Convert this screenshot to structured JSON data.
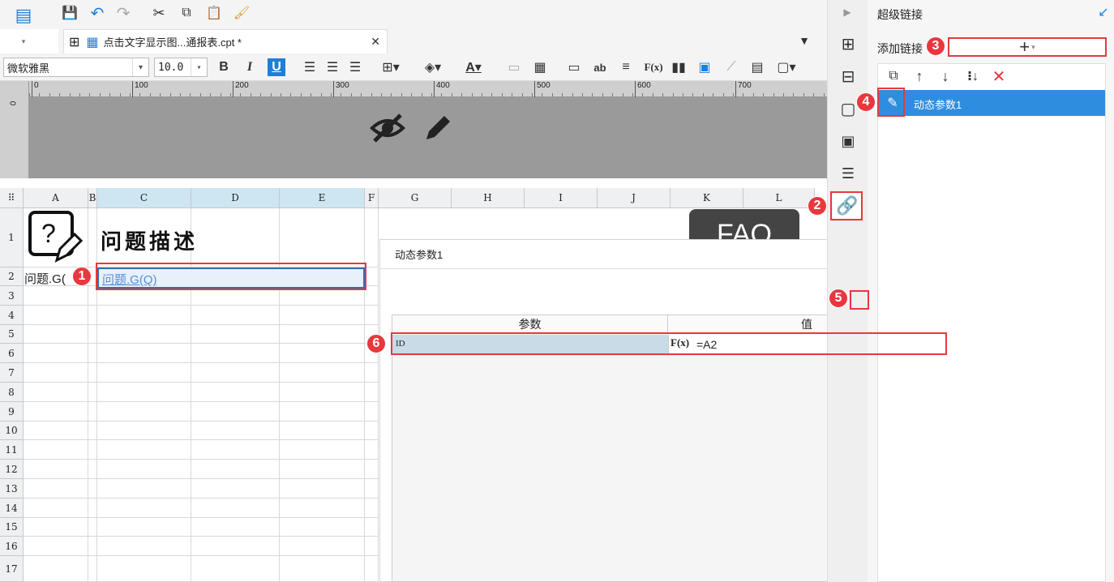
{
  "toolbar": {
    "icons": [
      "report-icon",
      "save-icon",
      "undo-icon",
      "redo-icon",
      "cut-icon",
      "copy-icon",
      "paste-icon",
      "format-painter-icon"
    ]
  },
  "tab": {
    "title": "点击文字显示图...通报表.cpt *",
    "close": "✕"
  },
  "format": {
    "font_name": "微软雅黑",
    "font_size": "10.0",
    "bold": "B",
    "italic": "I",
    "underline": "U",
    "ab": "ab",
    "fx": "F(x)"
  },
  "ruler": {
    "ticks": [
      "0",
      "100",
      "200",
      "300",
      "400",
      "500",
      "600",
      "700"
    ],
    "left": "0"
  },
  "sheet": {
    "corner": "⠿",
    "columns": [
      "A",
      "B",
      "C",
      "D",
      "E",
      "F",
      "G",
      "H",
      "I",
      "J",
      "K",
      "L"
    ],
    "rows": [
      "1",
      "2",
      "3",
      "4",
      "5",
      "6",
      "7",
      "8",
      "9",
      "10",
      "11",
      "12",
      "13",
      "14",
      "15",
      "16",
      "17"
    ],
    "title": "问题描述",
    "a2": "问题.G(",
    "c2": "问题.G(Q)",
    "faq": "FAQ"
  },
  "right_panel": {
    "title": "超级链接",
    "add_label": "添加链接",
    "item": "动态参数1"
  },
  "dialog": {
    "title": "动态参数1",
    "col_param": "参数",
    "col_value": "值",
    "row_param": "ID",
    "row_fx": "F(x)",
    "row_value": "=A2"
  },
  "badges": [
    "1",
    "2",
    "3",
    "4",
    "5",
    "6"
  ],
  "colors": {
    "accent": "#1e7fd6",
    "highlight": "#cde6f2",
    "badge": "#e8383d",
    "selected": "#2f8ddf"
  }
}
